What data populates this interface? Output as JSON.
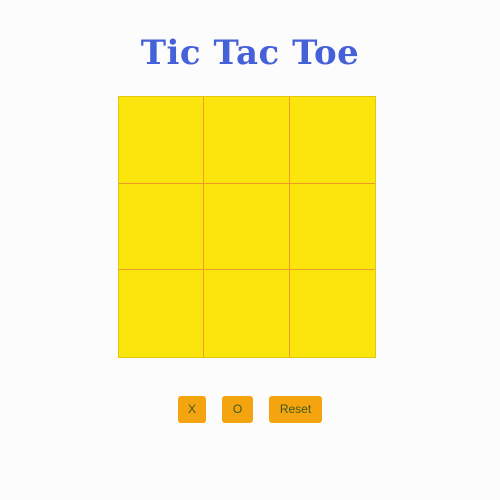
{
  "title": "Tic Tac Toe",
  "board": {
    "cells": [
      "",
      "",
      "",
      "",
      "",
      "",
      "",
      "",
      ""
    ]
  },
  "controls": {
    "x_label": "X",
    "o_label": "O",
    "reset_label": "Reset"
  },
  "colors": {
    "title": "#4561d8",
    "board": "#fae60c",
    "grid_lines": "#ef9a2a",
    "button_bg": "#f4a40f",
    "button_text": "#3c5a1e"
  }
}
